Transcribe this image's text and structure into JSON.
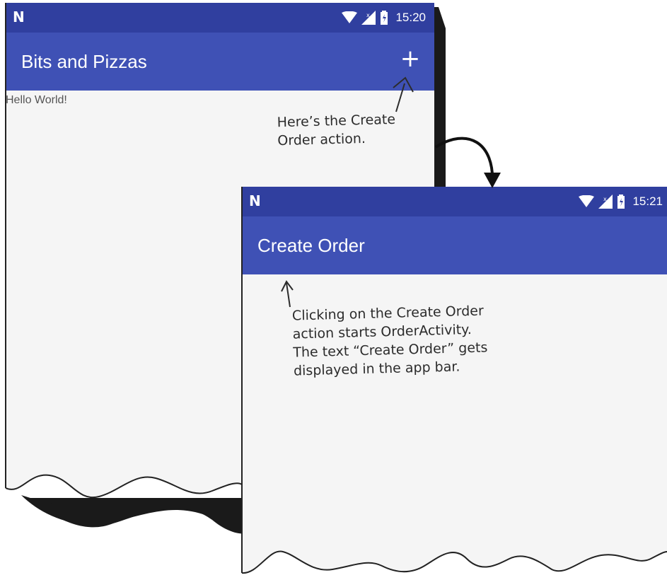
{
  "colors": {
    "status_bar": "#303f9f",
    "app_bar": "#3f51b5",
    "screen_background": "#f5f5f5",
    "annotation_ink": "#2c2c2c"
  },
  "screen1": {
    "status_logo_icon": "n-logo-icon",
    "time": "15:20",
    "app_title": "Bits and Pizzas",
    "action_icon": "plus-icon",
    "action_label": "+",
    "body_text": "Hello World!"
  },
  "screen2": {
    "status_logo_icon": "n-logo-icon",
    "time": "15:21",
    "app_title": "Create Order"
  },
  "annotations": {
    "create_order_action": [
      "Here’s the Create",
      "Order action."
    ],
    "order_activity": [
      "Clicking on the Create Order",
      "action starts OrderActivity.",
      "The text “Create Order” gets",
      "displayed in the app bar."
    ]
  }
}
